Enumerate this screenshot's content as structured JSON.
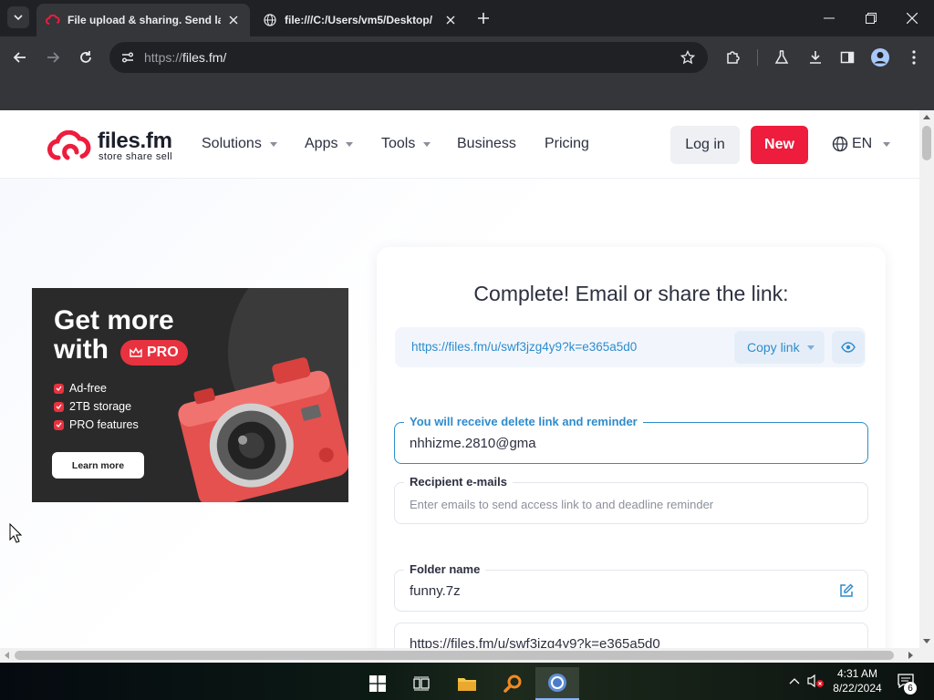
{
  "browser": {
    "tabs": [
      {
        "title": "File upload & sharing. Send lar",
        "favicon": "files-fm-cloud-icon",
        "active": true
      },
      {
        "title": "file:///C:/Users/vm5/Desktop/",
        "favicon": "globe-icon",
        "active": false
      }
    ],
    "address": {
      "scheme": "https://",
      "host": "files.fm/"
    }
  },
  "site": {
    "logo": {
      "brand": "files.fm",
      "tagline": "store  share  sell"
    },
    "nav": [
      {
        "label": "Solutions",
        "dropdown": true
      },
      {
        "label": "Apps",
        "dropdown": true
      },
      {
        "label": "Tools",
        "dropdown": true
      },
      {
        "label": "Business",
        "dropdown": false
      },
      {
        "label": "Pricing",
        "dropdown": false
      }
    ],
    "login_label": "Log in",
    "new_label": "New",
    "language": "EN"
  },
  "ad": {
    "line1": "Get more",
    "line2": "with",
    "badge": "PRO",
    "features": [
      "Ad-free",
      "2TB storage",
      "PRO features"
    ],
    "cta": "Learn more"
  },
  "share": {
    "title": "Complete! Email or share the link:",
    "link": "https://files.fm/u/swf3jzg4y9?k=e365a5d0",
    "copy_label": "Copy link",
    "owner_email": {
      "label": "You will receive delete link and reminder",
      "value": "nhhizme.2810@gma"
    },
    "recipients": {
      "label": "Recipient e-mails",
      "placeholder": "Enter emails to send access link to and deadline reminder"
    },
    "folder": {
      "label": "Folder name",
      "value": "funny.7z"
    },
    "link_field": {
      "value": "https://files.fm/u/swf3jzg4y9?k=e365a5d0"
    }
  },
  "taskbar": {
    "time": "4:31 AM",
    "date": "8/22/2024",
    "notifications": "6"
  },
  "colors": {
    "brand_red": "#ee1c3d",
    "link_blue": "#2e8ccc",
    "chrome_dark": "#202124"
  }
}
